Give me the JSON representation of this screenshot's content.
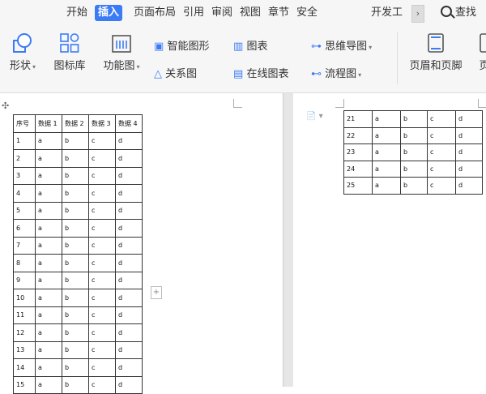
{
  "tabs": [
    "开始",
    "插入",
    "页面布局",
    "引用",
    "审阅",
    "视图",
    "章节",
    "安全",
    "开发工"
  ],
  "active_tab": "插入",
  "tab_scroll_glyph": "›",
  "search_label": "查找",
  "ribbon": {
    "shape": "形状",
    "icon_lib": "图标库",
    "func_chart": "功能图",
    "smart_shape": "智能图形",
    "chart": "图表",
    "mind_map": "思维导图",
    "relation": "关系图",
    "online_chart": "在线图表",
    "flowchart": "流程图",
    "header_footer": "页眉和页脚",
    "page_cut": "页"
  },
  "colors": {
    "accent": "#3b7bf6",
    "icon_blue": "#3b7bf6",
    "toolbar_bg": "#f6f6f6"
  },
  "table_left": {
    "headers": [
      "序号",
      "数据 1",
      "数据 2",
      "数据 3",
      "数据 4"
    ],
    "rows": [
      [
        "1",
        "a",
        "b",
        "c",
        "d"
      ],
      [
        "2",
        "a",
        "b",
        "c",
        "d"
      ],
      [
        "3",
        "a",
        "b",
        "c",
        "d"
      ],
      [
        "4",
        "a",
        "b",
        "c",
        "d"
      ],
      [
        "5",
        "a",
        "b",
        "c",
        "d"
      ],
      [
        "6",
        "a",
        "b",
        "c",
        "d"
      ],
      [
        "7",
        "a",
        "b",
        "c",
        "d"
      ],
      [
        "8",
        "a",
        "b",
        "c",
        "d"
      ],
      [
        "9",
        "a",
        "b",
        "c",
        "d"
      ],
      [
        "10",
        "a",
        "b",
        "c",
        "d"
      ],
      [
        "11",
        "a",
        "b",
        "c",
        "d"
      ],
      [
        "12",
        "a",
        "b",
        "c",
        "d"
      ],
      [
        "13",
        "a",
        "b",
        "c",
        "d"
      ],
      [
        "14",
        "a",
        "b",
        "c",
        "d"
      ],
      [
        "15",
        "a",
        "b",
        "c",
        "d"
      ]
    ]
  },
  "table_right": {
    "rows": [
      [
        "21",
        "a",
        "b",
        "c",
        "d"
      ],
      [
        "22",
        "a",
        "b",
        "c",
        "d"
      ],
      [
        "23",
        "a",
        "b",
        "c",
        "d"
      ],
      [
        "24",
        "a",
        "b",
        "c",
        "d"
      ],
      [
        "25",
        "a",
        "b",
        "c",
        "d"
      ]
    ]
  },
  "add_row_glyph": "+",
  "move_handle_glyph": "✣"
}
